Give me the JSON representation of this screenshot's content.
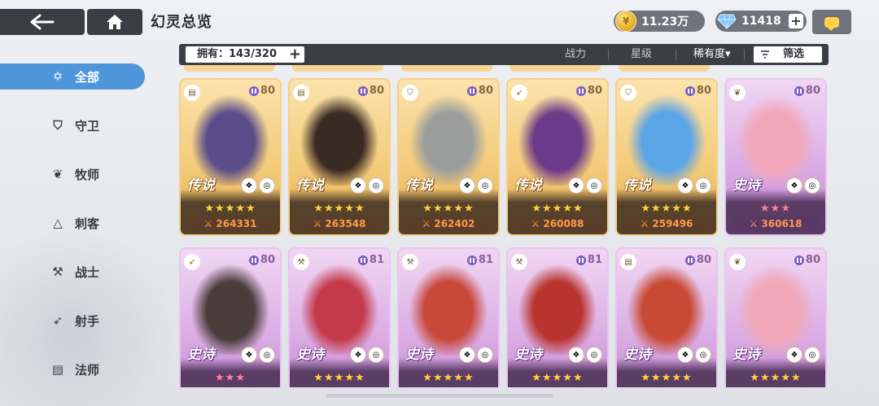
{
  "header": {
    "title": "幻灵总览",
    "gold": "11.23万",
    "gems": "11418",
    "plus_symbol": "+"
  },
  "filter": {
    "owned_label": "拥有：143/320",
    "sort_power": "战力",
    "sort_star": "星级",
    "sort_rarity": "稀有度▾",
    "screen_label": "筛选"
  },
  "sidebar": {
    "items": [
      {
        "label": "全部",
        "icon": "all-star-icon",
        "active": true
      },
      {
        "label": "守卫",
        "icon": "shield-icon",
        "active": false
      },
      {
        "label": "牧师",
        "icon": "wings-icon",
        "active": false
      },
      {
        "label": "刺客",
        "icon": "hood-icon",
        "active": false
      },
      {
        "label": "战士",
        "icon": "hammer-icon",
        "active": false
      },
      {
        "label": "射手",
        "icon": "bow-icon",
        "active": false
      },
      {
        "label": "法师",
        "icon": "book-icon",
        "active": false
      }
    ]
  },
  "cards": [
    {
      "rarity": "传说",
      "tier": "legend",
      "level": "80",
      "stars": "★★★★★",
      "power": "264331",
      "class_icon": "book-icon",
      "hue": "#5a4d8a"
    },
    {
      "rarity": "传说",
      "tier": "legend",
      "level": "80",
      "stars": "★★★★★",
      "power": "263548",
      "class_icon": "book-icon",
      "hue": "#3a2a24"
    },
    {
      "rarity": "传说",
      "tier": "legend",
      "level": "80",
      "stars": "★★★★★",
      "power": "262402",
      "class_icon": "shield-icon",
      "hue": "#9a9d9c"
    },
    {
      "rarity": "传说",
      "tier": "legend",
      "level": "80",
      "stars": "★★★★★",
      "power": "260088",
      "class_icon": "bow-icon",
      "hue": "#6b3a8a"
    },
    {
      "rarity": "传说",
      "tier": "legend",
      "level": "80",
      "stars": "★★★★★",
      "power": "259496",
      "class_icon": "shield-icon",
      "hue": "#5aa4e8"
    },
    {
      "rarity": "史诗",
      "tier": "epic",
      "level": "80",
      "stars": "★★★",
      "power": "360618",
      "class_icon": "wings-icon",
      "hue": "#f2a7b8"
    },
    {
      "rarity": "史诗",
      "tier": "epic",
      "level": "80",
      "stars": "★★★",
      "power": "",
      "class_icon": "bow-icon",
      "hue": "#4a3d3a"
    },
    {
      "rarity": "史诗",
      "tier": "epic",
      "level": "81",
      "stars": "★★★★★",
      "power": "",
      "class_icon": "hammer-icon",
      "hue": "#c43a4a"
    },
    {
      "rarity": "史诗",
      "tier": "epic",
      "level": "81",
      "stars": "★★★★★",
      "power": "",
      "class_icon": "hammer-icon",
      "hue": "#c8483a"
    },
    {
      "rarity": "史诗",
      "tier": "epic",
      "level": "81",
      "stars": "★★★★★",
      "power": "",
      "class_icon": "hammer-icon",
      "hue": "#b8342e"
    },
    {
      "rarity": "史诗",
      "tier": "epic",
      "level": "80",
      "stars": "★★★★★",
      "power": "",
      "class_icon": "book-icon",
      "hue": "#c84a34"
    },
    {
      "rarity": "史诗",
      "tier": "epic",
      "level": "80",
      "stars": "★★★★★",
      "power": "",
      "class_icon": "wings-icon",
      "hue": "#f0a8b8"
    }
  ]
}
